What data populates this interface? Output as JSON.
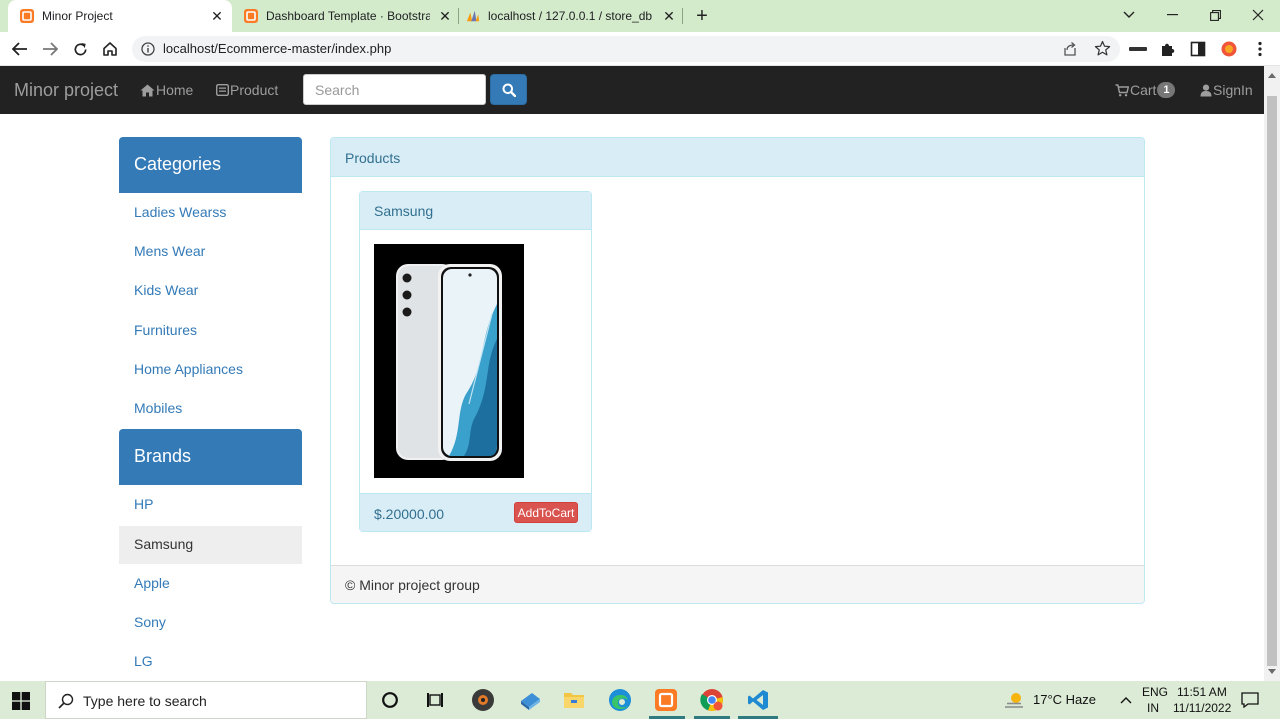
{
  "browser": {
    "tabs": [
      {
        "title": "Minor Project",
        "active": true
      },
      {
        "title": "Dashboard Template · Bootstrap",
        "active": false
      },
      {
        "title": "localhost / 127.0.0.1 / store_db /",
        "active": false
      }
    ],
    "url": "localhost/Ecommerce-master/index.php"
  },
  "navbar": {
    "brand": "Minor project",
    "home": "Home",
    "product": "Product",
    "search_placeholder": "Search",
    "cart": "Cart",
    "cart_count": "1",
    "signin": "SignIn"
  },
  "sidebar": {
    "categories_title": "Categories",
    "categories": [
      "Ladies Wearss",
      "Mens Wear",
      "Kids Wear",
      "Furnitures",
      "Home Appliances",
      "Mobiles"
    ],
    "brands_title": "Brands",
    "brands": [
      "HP",
      "Samsung",
      "Apple",
      "Sony",
      "LG"
    ],
    "selected_brand": "Samsung"
  },
  "products": {
    "panel_title": "Products",
    "items": [
      {
        "name": "Samsung",
        "price": "$.20000.00",
        "button": "AddToCart"
      }
    ],
    "footer": "© Minor project group"
  },
  "taskbar": {
    "search_placeholder": "Type here to search",
    "weather": "17°C  Haze",
    "lang1": "ENG",
    "lang2": "IN",
    "time": "11:51 AM",
    "date": "11/11/2022"
  },
  "colors": {
    "primary": "#337ab7",
    "navbar": "#222222",
    "info_bg": "#d9edf7",
    "danger": "#d9534f",
    "chrome_tabstrip": "#d3eacb"
  }
}
